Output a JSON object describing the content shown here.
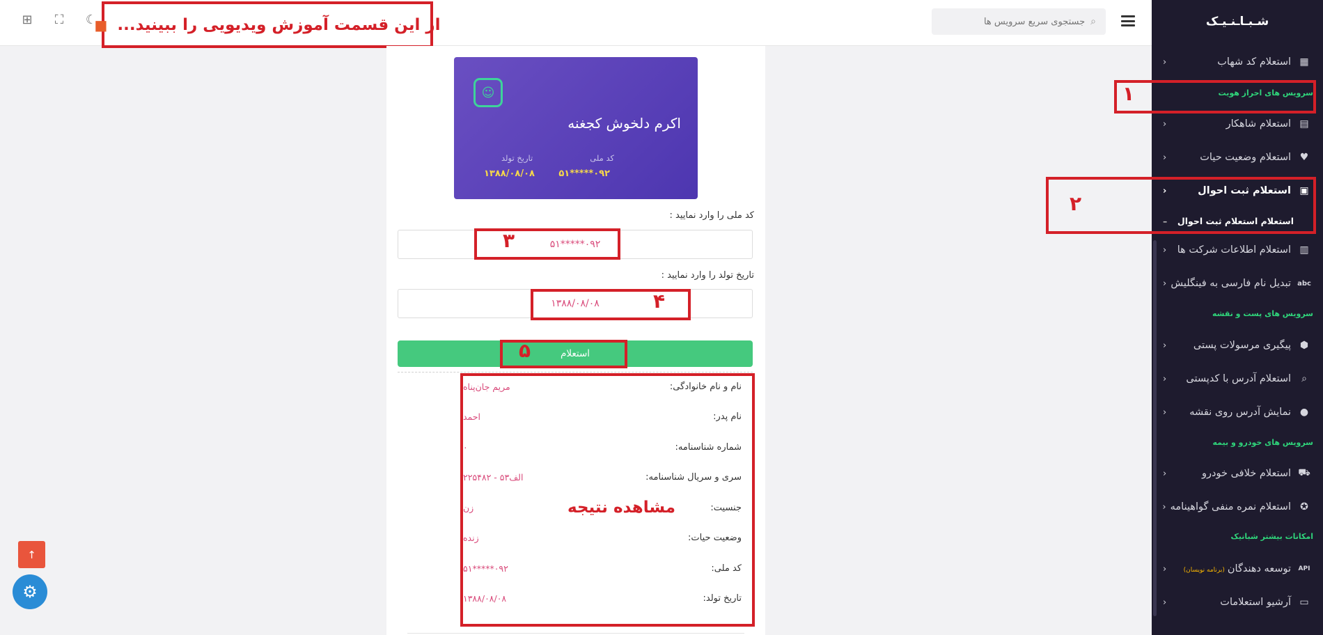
{
  "brand": "شـبـاـنـیـک",
  "sidebar": {
    "items": [
      {
        "label": "استعلام کد شهاب",
        "icon": "qrcode-icon"
      },
      {
        "label": "استعلام شاهکار",
        "icon": "id-card-icon"
      },
      {
        "label": "استعلام وضعیت حیات",
        "icon": "heart-icon"
      },
      {
        "label": "استعلام ثبت احوال",
        "icon": "person-card-icon"
      },
      {
        "label": "استعلام اطلاعات شرکت ها",
        "icon": "building-icon"
      },
      {
        "label": "تبدیل نام فارسی به فینگلیش",
        "icon": "abc-icon"
      },
      {
        "label": "پیگیری مرسولات پستی",
        "icon": "package-icon"
      },
      {
        "label": "استعلام آدرس با کدپستی",
        "icon": "map-search-icon"
      },
      {
        "label": "نمایش آدرس روی نقشه",
        "icon": "location-pin-icon"
      },
      {
        "label": "استعلام خلافی خودرو",
        "icon": "car-icon"
      },
      {
        "label": "استعلام نمره منفی گواهینامه",
        "icon": "badge-icon"
      },
      {
        "label": "توسعه دهندگان",
        "note": "(برنامه نویسان)",
        "icon": "api-icon"
      },
      {
        "label": "آرشیو استعلامات",
        "icon": "archive-icon"
      }
    ],
    "sub_item": "استعلام استعلام ثبت احوال",
    "sections": {
      "identity": "سرویس های احراز هویت",
      "post": "سرویس های پست و نقشه",
      "vehicle": "سرویس های خودرو و بیمه",
      "more": "امکانات بیشتر شبانیک"
    },
    "api_icon_text": "API",
    "abc_icon_text": "abc"
  },
  "header": {
    "search_placeholder": "جستجوی سریع سرویس ها",
    "video_banner": "از این قسمت آموزش ویدیویی را ببینید...",
    "icons": [
      "moon-icon",
      "fullscreen-icon",
      "apps-grid-icon"
    ]
  },
  "card": {
    "name": "اکرم دلخوش کجغنه",
    "national_id_label": "کد ملی",
    "national_id_value": "۰۹۲*****۵۱",
    "birth_label": "تاریخ تولد",
    "birth_value": "۱۳۸۸/۰۸/۰۸"
  },
  "form": {
    "national_id_label": "کد ملی را وارد نمایید :",
    "national_id_value": "۰۹۲*****۵۱",
    "birth_label": "تاریخ تولد را وارد نمایید :",
    "birth_value": "۱۳۸۸/۰۸/۰۸",
    "submit": "استعلام"
  },
  "result": {
    "rows": [
      {
        "key": "نام و نام خانوادگی:",
        "value": "مریم جان‌پناه"
      },
      {
        "key": "نام پدر:",
        "value": "احمد"
      },
      {
        "key": "شماره شناسنامه:",
        "value": "۰"
      },
      {
        "key": "سری و سریال شناسنامه:",
        "value": "الف۵۳ - ۲۲۵۴۸۲"
      },
      {
        "key": "جنسیت:",
        "value": "زن"
      },
      {
        "key": "وضعیت حیات:",
        "value": "زنده"
      },
      {
        "key": "کد ملی:",
        "value": "۰۹۲*****۵۱"
      },
      {
        "key": "تاریخ تولد:",
        "value": "۱۳۸۸/۰۸/۰۸"
      }
    ],
    "caption": "مشاهده نتیجه"
  },
  "annotations": {
    "n1": "۱",
    "n2": "۲",
    "n3": "۳",
    "n4": "۴",
    "n5": "۵"
  },
  "colors": {
    "sidebar_bg": "#1e1b2e",
    "accent_green": "#45c97e",
    "annotation_red": "#d42028",
    "card_purple": "#5a40bb",
    "value_pink": "#d94b7b"
  }
}
